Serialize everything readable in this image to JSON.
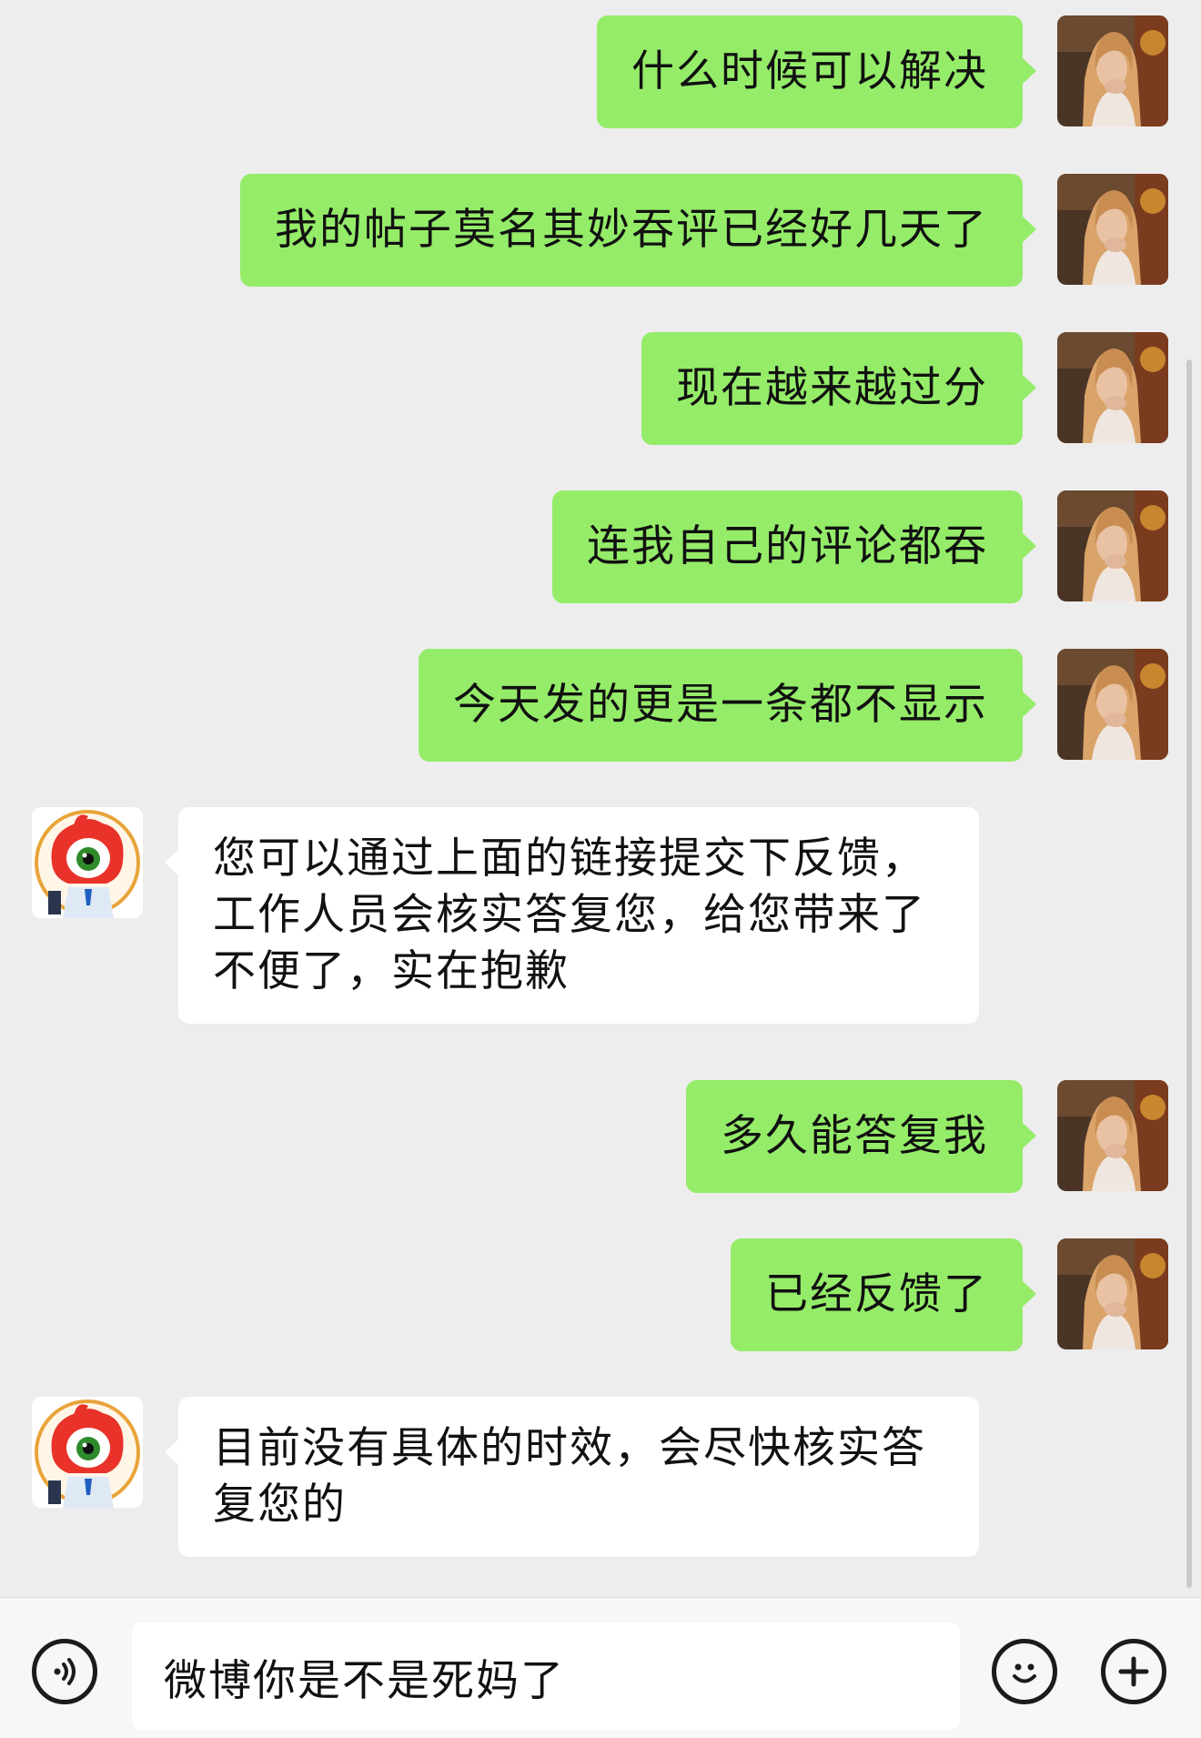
{
  "messages": [
    {
      "sender": "me",
      "text": "什么时候可以解决"
    },
    {
      "sender": "me",
      "text": "我的帖子莫名其妙吞评已经好几天了"
    },
    {
      "sender": "me",
      "text": "现在越来越过分"
    },
    {
      "sender": "me",
      "text": "连我自己的评论都吞"
    },
    {
      "sender": "me",
      "text": "今天发的更是一条都不显示"
    },
    {
      "sender": "service",
      "text": "您可以通过上面的链接提交下反馈，工作人员会核实答复您，给您带来了不便了，实在抱歉"
    },
    {
      "sender": "me",
      "text": "多久能答复我"
    },
    {
      "sender": "me",
      "text": "已经反馈了"
    },
    {
      "sender": "service",
      "text": "目前没有具体的时效，会尽快核实答复您的"
    }
  ],
  "input_bar": {
    "voice_icon": "voice-icon",
    "input_value": "微博你是不是死妈了",
    "emoji_icon": "emoji-icon",
    "more_icon": "plus-icon"
  },
  "colors": {
    "background": "#ededed",
    "my_bubble": "#95ec69",
    "service_bubble": "#ffffff"
  }
}
